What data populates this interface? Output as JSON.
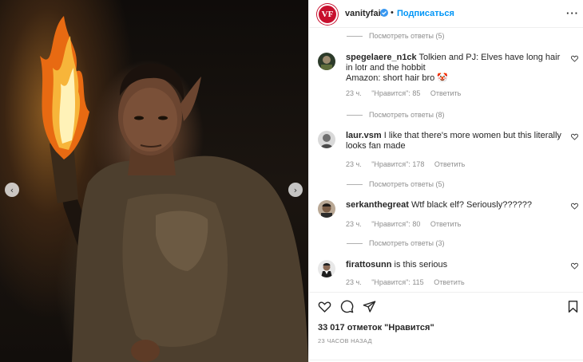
{
  "post": {
    "carousel_prev_glyph": "‹",
    "carousel_next_glyph": "›"
  },
  "header": {
    "logo_text": "VF",
    "username": "vanityfair",
    "separator": "•",
    "follow_label": "Подписаться",
    "more_glyph": "···"
  },
  "comments": {
    "top_replies": "Посмотреть ответы (5)",
    "items": [
      {
        "username": "spegelaere_n1ck",
        "text": "Tolkien and PJ: Elves have long hair in lotr and the hobbit",
        "text2": "Amazon: short hair bro",
        "emoji": "🤡",
        "time": "23 ч.",
        "likes": "\"Нравится\": 85",
        "reply": "Ответить",
        "view_replies": "Посмотреть ответы (8)"
      },
      {
        "username": "laur.vsm",
        "text": "I like that there's more women but this literally looks fan made",
        "time": "23 ч.",
        "likes": "\"Нравится\": 178",
        "reply": "Ответить",
        "view_replies": "Посмотреть ответы (5)"
      },
      {
        "username": "serkanthegreat",
        "text": "Wtf black elf? Seriously??????",
        "time": "23 ч.",
        "likes": "\"Нравится\": 80",
        "reply": "Ответить",
        "view_replies": "Посмотреть ответы (3)"
      },
      {
        "username": "firattosunn",
        "text": "is this serious",
        "time": "23 ч.",
        "likes": "\"Нравится\": 115",
        "reply": "Ответить"
      }
    ]
  },
  "actions": {
    "likes_count": "33 017 отметок \"Нравится\"",
    "posted_ago": "23 часов назад"
  },
  "colors": {
    "link_blue": "#0095f6",
    "brand_red": "#c8102e",
    "verified_blue": "#3897f0",
    "secondary_text": "#8e8e8e"
  }
}
